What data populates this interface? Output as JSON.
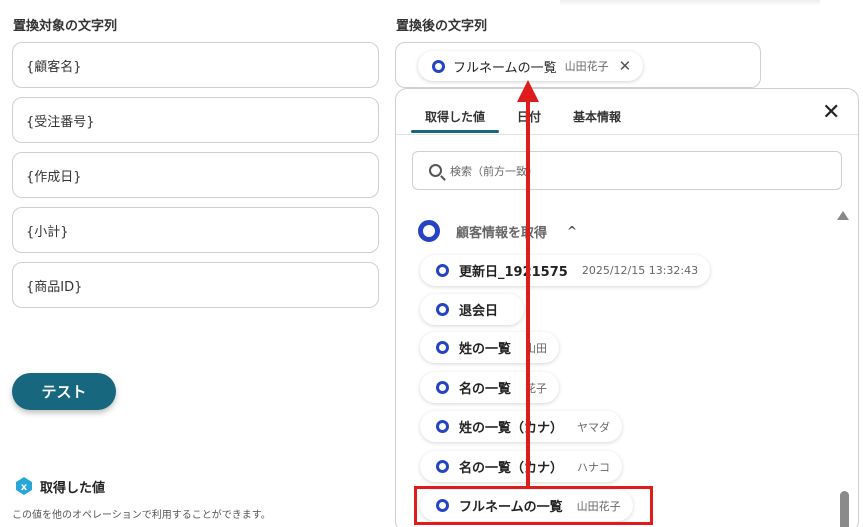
{
  "left": {
    "label": "置換対象の文字列",
    "fields": [
      "{顧客名}",
      "{受注番号}",
      "{作成日}",
      "{小計}",
      "{商品ID}"
    ],
    "test_button": "テスト",
    "acquired_title": "取得した値",
    "acquired_desc": "この値を他のオペレーションで利用することができます。"
  },
  "right": {
    "label": "置換後の文字列",
    "chip": {
      "label": "フルネームの一覧",
      "value": "山田花子",
      "remove": "✕"
    }
  },
  "panel": {
    "tabs": [
      "取得した値",
      "日付",
      "基本情報"
    ],
    "close": "✕",
    "search_placeholder": "検索（前方一致）",
    "group": {
      "title": "顧客情報を取得",
      "caret": "^"
    },
    "items": [
      {
        "label": "更新日_1921575",
        "value": "2025/12/15 13:32:43"
      },
      {
        "label": "退会日",
        "value": ""
      },
      {
        "label": "姓の一覧",
        "value": "山田"
      },
      {
        "label": "名の一覧",
        "value": "花子"
      },
      {
        "label": "姓の一覧（カナ）",
        "value": "ヤマダ"
      },
      {
        "label": "名の一覧（カナ）",
        "value": "ハナコ"
      },
      {
        "label": "フルネームの一覧",
        "value": "山田花子"
      }
    ]
  },
  "colors": {
    "accent": "#17677f",
    "ring": "#2544c4",
    "annotation": "#e01b1b"
  }
}
